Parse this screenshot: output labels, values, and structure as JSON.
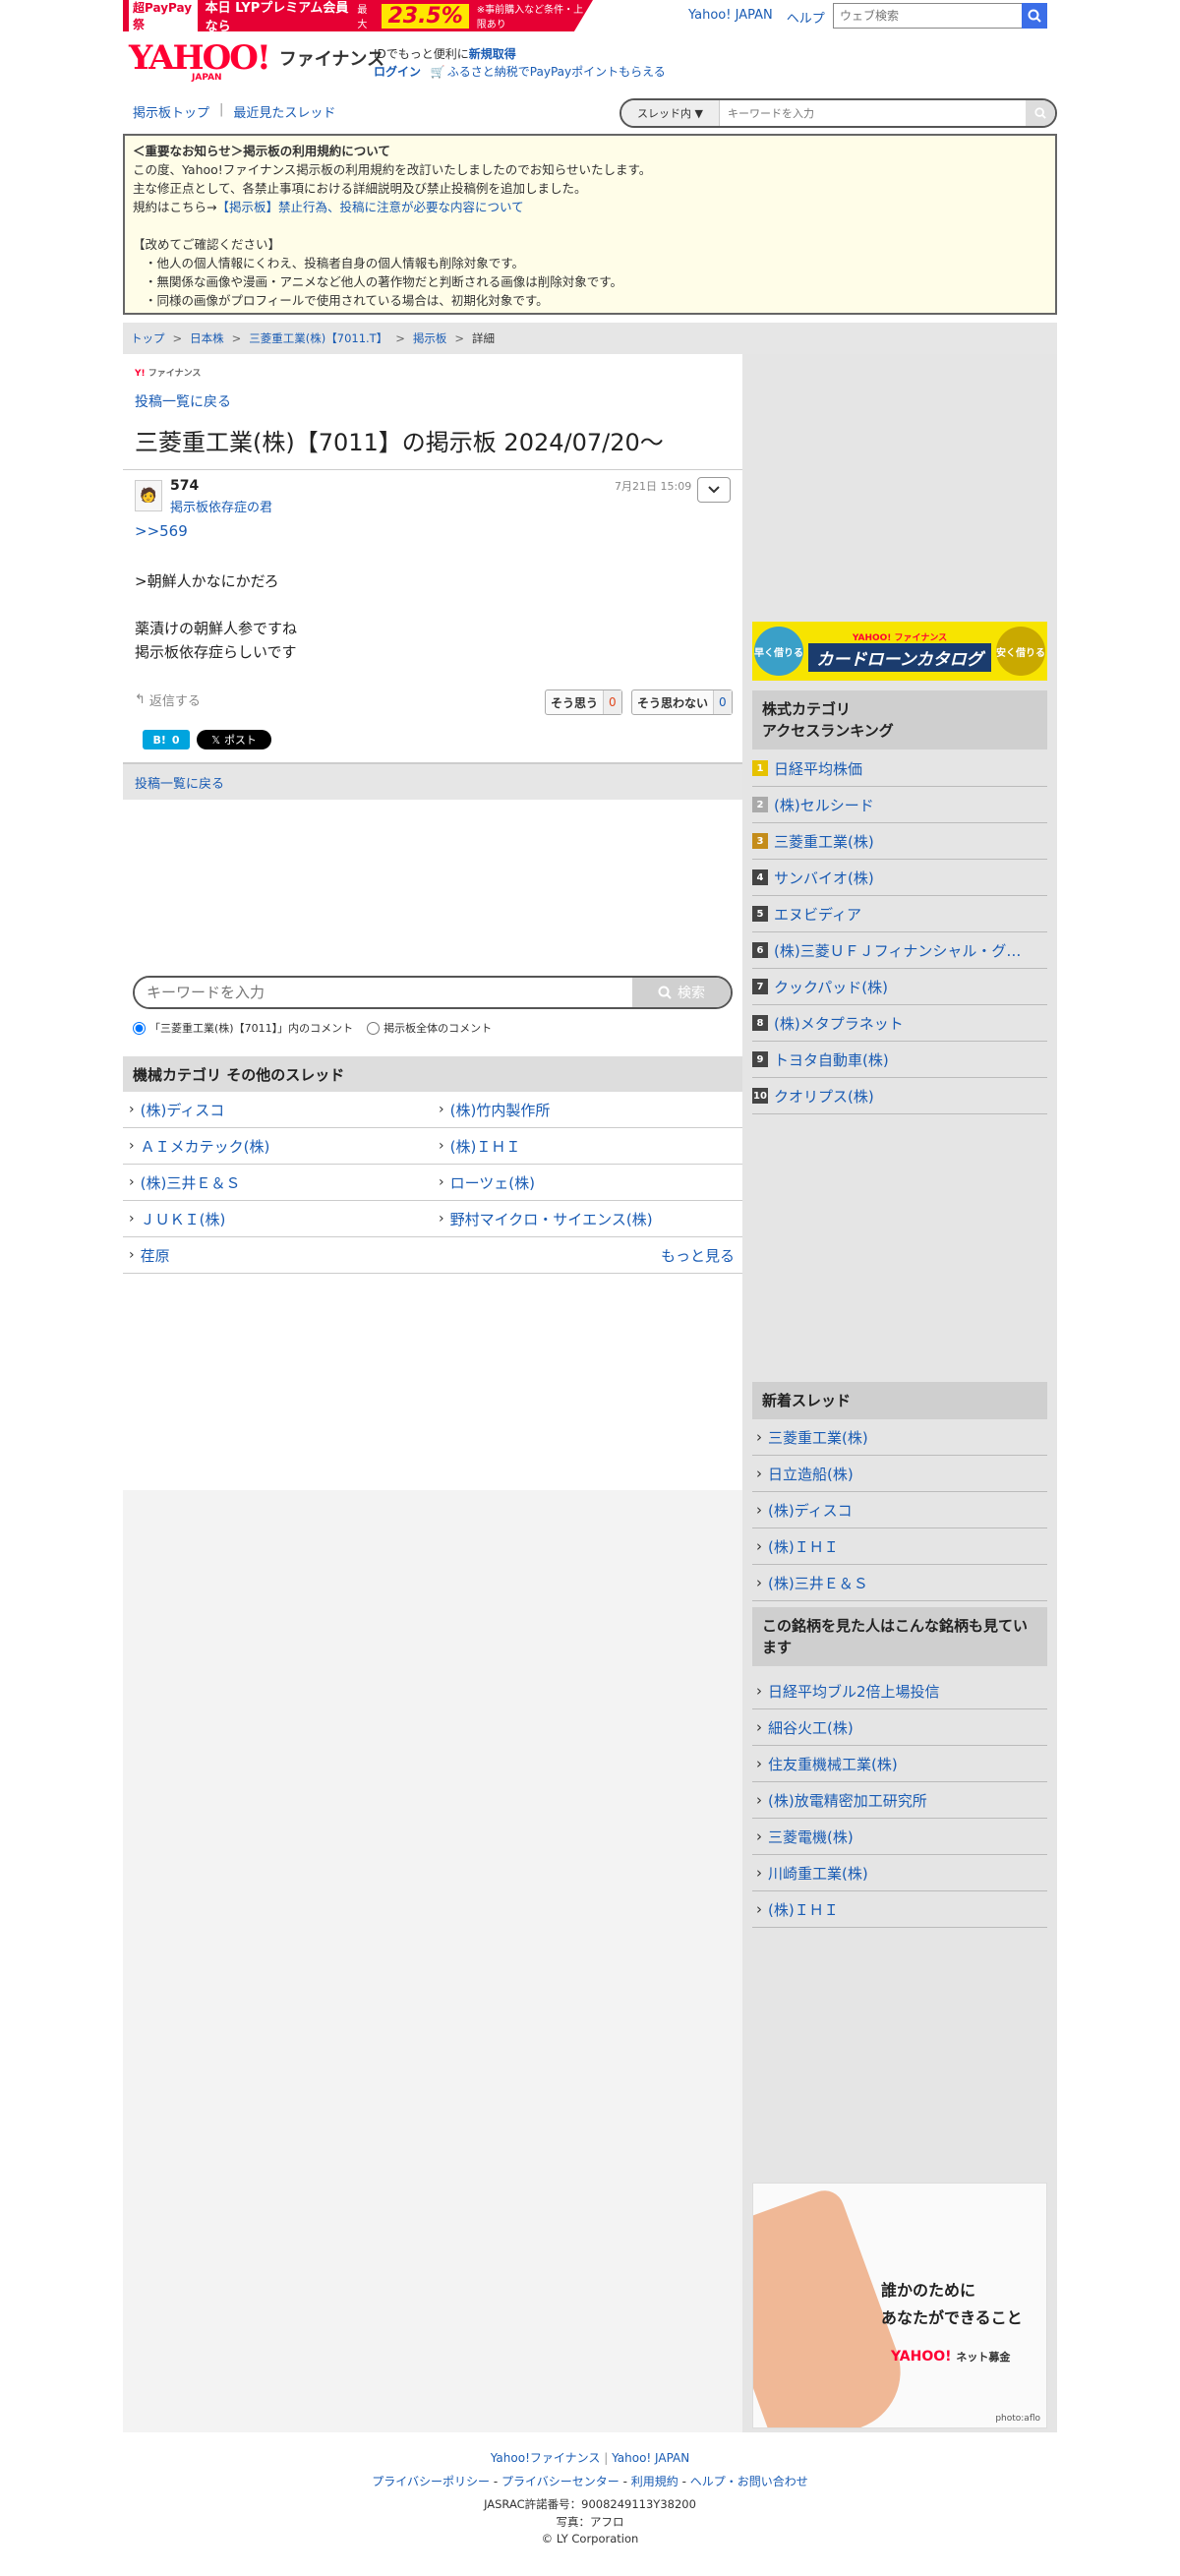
{
  "topbar": {
    "promo_tag": "超PayPay祭",
    "promo_text": "本日 LYPプレミアム会員なら",
    "promo_rate_prefix": "最大",
    "promo_rate": "23.5%",
    "promo_note": "※事前購入など条件・上限あり",
    "links": [
      "Yahoo! JAPAN",
      "ヘルプ"
    ],
    "search_placeholder": "ウェブ検索"
  },
  "header": {
    "logo": "YAHOO!",
    "logo_sub": "JAPAN",
    "service": "ファイナンス",
    "info_line1": "IDでもっと便利に",
    "signup": "新規取得",
    "login": "ログイン",
    "furusato": "ふるさと納税でPayPayポイントもらえる"
  },
  "nav": {
    "board_top": "掲示板トップ",
    "recent": "最近見たスレッド",
    "scope": "スレッド内",
    "search_placeholder": "キーワードを入力"
  },
  "notice": {
    "title": "＜重要なお知らせ＞掲示板の利用規約について",
    "line1": "この度、Yahoo!ファイナンス掲示板の利用規約を改訂いたしましたのでお知らせいたします。",
    "line2": "主な修正点として、各禁止事項における詳細説明及び禁止投稿例を追加しました。",
    "line3_prefix": "規約はこちら→",
    "line3_link": "【掲示板】禁止行為、投稿に注意が必要な内容について",
    "confirm": "【改めてご確認ください】",
    "items": [
      "・他人の個人情報にくわえ、投稿者自身の個人情報も削除対象です。",
      "・無関係な画像や漫画・アニメなど他人の著作物だと判断される画像は削除対象です。",
      "・同様の画像がプロフィールで使用されている場合は、初期化対象です。"
    ]
  },
  "breadcrumb": [
    "トップ",
    "日本株",
    "三菱重工業(株)【7011.T】",
    "掲示板",
    "詳細"
  ],
  "main": {
    "mini_logo": "ファイナンス",
    "back_link": "投稿一覧に戻る",
    "title": "三菱重工業(株)【7011】の掲示板 2024/07/20〜",
    "post": {
      "number": "574",
      "author": "掲示板依存症の君",
      "time": "7月21日 15:09",
      "reply_to": ">>569",
      "body": ">朝鮮人かなにかだろ\n\n薬漬けの朝鮮人参ですね\n掲示板依存症らしいです",
      "reply_label": "返信する",
      "agree_label": "そう思う",
      "agree_count": "0",
      "disagree_label": "そう思わない",
      "disagree_count": "0",
      "hatena_count": "0",
      "x_post": "ポスト"
    },
    "back_bar": "投稿一覧に戻る",
    "keyword_placeholder": "キーワードを入力",
    "keyword_button": "検索",
    "scope_this": "「三菱重工業(株)【7011】」内のコメント",
    "scope_all": "掲示板全体のコメント",
    "other_threads_title": "機械カテゴリ  その他のスレッド",
    "other_threads": [
      [
        "(株)ディスコ",
        "(株)竹内製作所"
      ],
      [
        "ＡＩメカテック(株)",
        "(株)ＩＨＩ"
      ],
      [
        "(株)三井Ｅ＆Ｓ",
        "ローツェ(株)"
      ],
      [
        "ＪＵＫＩ(株)",
        "野村マイクロ・サイエンス(株)"
      ],
      [
        "荏原",
        ""
      ]
    ],
    "more_link": "もっと見る"
  },
  "sidebar": {
    "banner_left": "早く借りる",
    "banner_brand": "YAHOO! ファイナンス",
    "banner_title": "カードローンカタログ",
    "banner_right": "安く借りる",
    "ranking_title": "株式カテゴリ\nアクセスランキング",
    "ranking": [
      "日経平均株価",
      "(株)セルシード",
      "三菱重工業(株)",
      "サンバイオ(株)",
      "エヌビディア",
      "(株)三菱ＵＦＪフィナンシャル・グ…",
      "クックパッド(株)",
      "(株)メタプラネット",
      "トヨタ自動車(株)",
      "クオリプス(株)"
    ],
    "new_threads_title": "新着スレッド",
    "new_threads": [
      "三菱重工業(株)",
      "日立造船(株)",
      "(株)ディスコ",
      "(株)ＩＨＩ",
      "(株)三井Ｅ＆Ｓ"
    ],
    "related_title": "この銘柄を見た人はこんな銘柄も見ています",
    "related": [
      "日経平均ブル2倍上場投信",
      "細谷火工(株)",
      "住友重機械工業(株)",
      "(株)放電精密加工研究所",
      "三菱電機(株)",
      "川崎重工業(株)",
      "(株)ＩＨＩ"
    ],
    "ad_line1": "誰かのために",
    "ad_line2": "あなたができること",
    "ad_brand": "YAHOO!",
    "ad_brand_sub": "ネット募金",
    "ad_credit": "photo:aflo"
  },
  "footer": {
    "links1": [
      "Yahoo!ファイナンス",
      "Yahoo! JAPAN"
    ],
    "links2": [
      "プライバシーポリシー",
      "プライバシーセンター",
      "利用規約",
      "ヘルプ・お問い合わせ"
    ],
    "jasrac": "JASRAC許諾番号：9008249113Y38200",
    "photo": "写真：アフロ",
    "copyright": "© LY Corporation"
  }
}
